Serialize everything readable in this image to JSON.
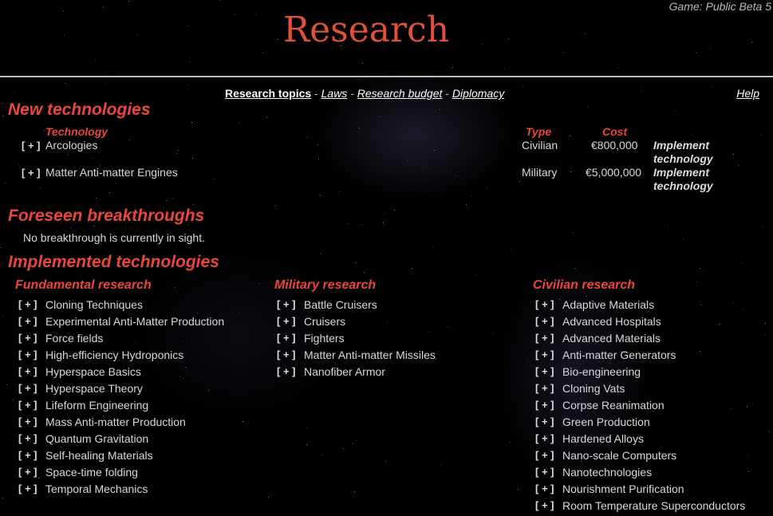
{
  "header": {
    "game_label": "Game: Public Beta 5",
    "title": "Research"
  },
  "nav": {
    "items": [
      "Research topics",
      "Laws",
      "Research budget",
      "Diplomacy"
    ],
    "separator": " - ",
    "help": "Help"
  },
  "new_tech": {
    "heading": "New technologies",
    "col_technology": "Technology",
    "col_type": "Type",
    "col_cost": "Cost",
    "rows": [
      {
        "toggle": "[ + ]",
        "name": "Arcologies",
        "type": "Civilian",
        "cost": "€800,000",
        "action": "Implement technology"
      },
      {
        "toggle": "[ + ]",
        "name": "Matter Anti-matter Engines",
        "type": "Military",
        "cost": "€5,000,000",
        "action": "Implement technology"
      }
    ]
  },
  "foreseen": {
    "heading": "Foreseen breakthroughs",
    "text": "No breakthrough is currently in sight."
  },
  "implemented": {
    "heading": "Implemented technologies",
    "toggle": "[ + ]",
    "fundamental": {
      "heading": "Fundamental research",
      "items": [
        "Cloning Techniques",
        "Experimental Anti-Matter Production",
        "Force fields",
        "High-efficiency Hydroponics",
        "Hyperspace Basics",
        "Hyperspace Theory",
        "Lifeform Engineering",
        "Mass Anti-matter Production",
        "Quantum Gravitation",
        "Self-healing Materials",
        "Space-time folding",
        "Temporal Mechanics"
      ]
    },
    "military": {
      "heading": "Military research",
      "items": [
        "Battle Cruisers",
        "Cruisers",
        "Fighters",
        "Matter Anti-matter Missiles",
        "Nanofiber Armor"
      ]
    },
    "civilian": {
      "heading": "Civilian research",
      "items": [
        "Adaptive Materials",
        "Advanced Hospitals",
        "Advanced Materials",
        "Anti-matter Generators",
        "Bio-engineering",
        "Cloning Vats",
        "Corpse Reanimation",
        "Green Production",
        "Hardened Alloys",
        "Nano-scale Computers",
        "Nanotechnologies",
        "Nourishment Purification",
        "Room Temperature Superconductors"
      ]
    }
  }
}
